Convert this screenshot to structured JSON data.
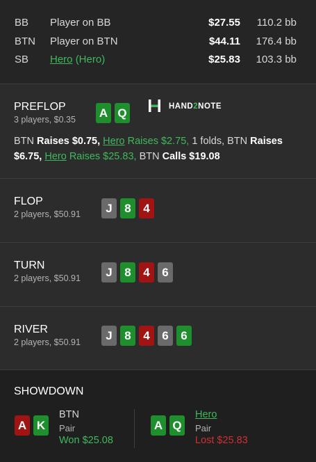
{
  "players": [
    {
      "pos": "BB",
      "name": "Player on BB",
      "stack": "$27.55",
      "bb": "110.2 bb"
    },
    {
      "pos": "BTN",
      "name": "Player on BTN",
      "stack": "$44.11",
      "bb": "176.4 bb"
    },
    {
      "pos": "SB",
      "name": "Hero",
      "name_tag": "(Hero)",
      "stack": "$25.83",
      "bb": "103.3 bb"
    }
  ],
  "logo": {
    "part1": "HAND",
    "part2": "2",
    "part3": "NOTE"
  },
  "preflop": {
    "title": "PREFLOP",
    "sub": "3 players, $0.35",
    "cards": [
      {
        "rank": "A",
        "color": "green"
      },
      {
        "rank": "Q",
        "color": "green"
      }
    ],
    "actions": {
      "a1": "BTN",
      "a2": "Raises $0.75,",
      "a3": "Hero",
      "a4": "Raises $2.75,",
      "a5": "1 folds,",
      "a6": "BTN",
      "a7": "Raises",
      "a8": "$6.75,",
      "a9": "Hero",
      "a10": "Raises $25.83,",
      "a11": "BTN",
      "a12": "Calls $19.08"
    }
  },
  "flop": {
    "title": "FLOP",
    "sub": "2 players, $50.91",
    "cards": [
      {
        "rank": "J",
        "color": "grey"
      },
      {
        "rank": "8",
        "color": "green"
      },
      {
        "rank": "4",
        "color": "red"
      }
    ]
  },
  "turn": {
    "title": "TURN",
    "sub": "2 players, $50.91",
    "cards": [
      {
        "rank": "J",
        "color": "grey"
      },
      {
        "rank": "8",
        "color": "green"
      },
      {
        "rank": "4",
        "color": "red"
      },
      {
        "rank": "6",
        "color": "grey"
      }
    ]
  },
  "river": {
    "title": "RIVER",
    "sub": "2 players, $50.91",
    "cards": [
      {
        "rank": "J",
        "color": "grey"
      },
      {
        "rank": "8",
        "color": "green"
      },
      {
        "rank": "4",
        "color": "red"
      },
      {
        "rank": "6",
        "color": "grey"
      },
      {
        "rank": "6",
        "color": "green"
      }
    ]
  },
  "showdown": {
    "title": "SHOWDOWN",
    "left": {
      "name": "BTN",
      "hand": "Pair",
      "result": "Won $25.08",
      "cards": [
        {
          "rank": "A",
          "color": "red"
        },
        {
          "rank": "K",
          "color": "green"
        }
      ]
    },
    "right": {
      "name": "Hero",
      "hand": "Pair",
      "result": "Lost $25.83",
      "cards": [
        {
          "rank": "A",
          "color": "green"
        },
        {
          "rank": "Q",
          "color": "green"
        }
      ]
    }
  },
  "colors": {
    "green_card": "#1f8f2e",
    "red_card": "#a01414",
    "grey_card": "#6a6a6a",
    "hero": "#3fb95c",
    "lost": "#d03030"
  }
}
